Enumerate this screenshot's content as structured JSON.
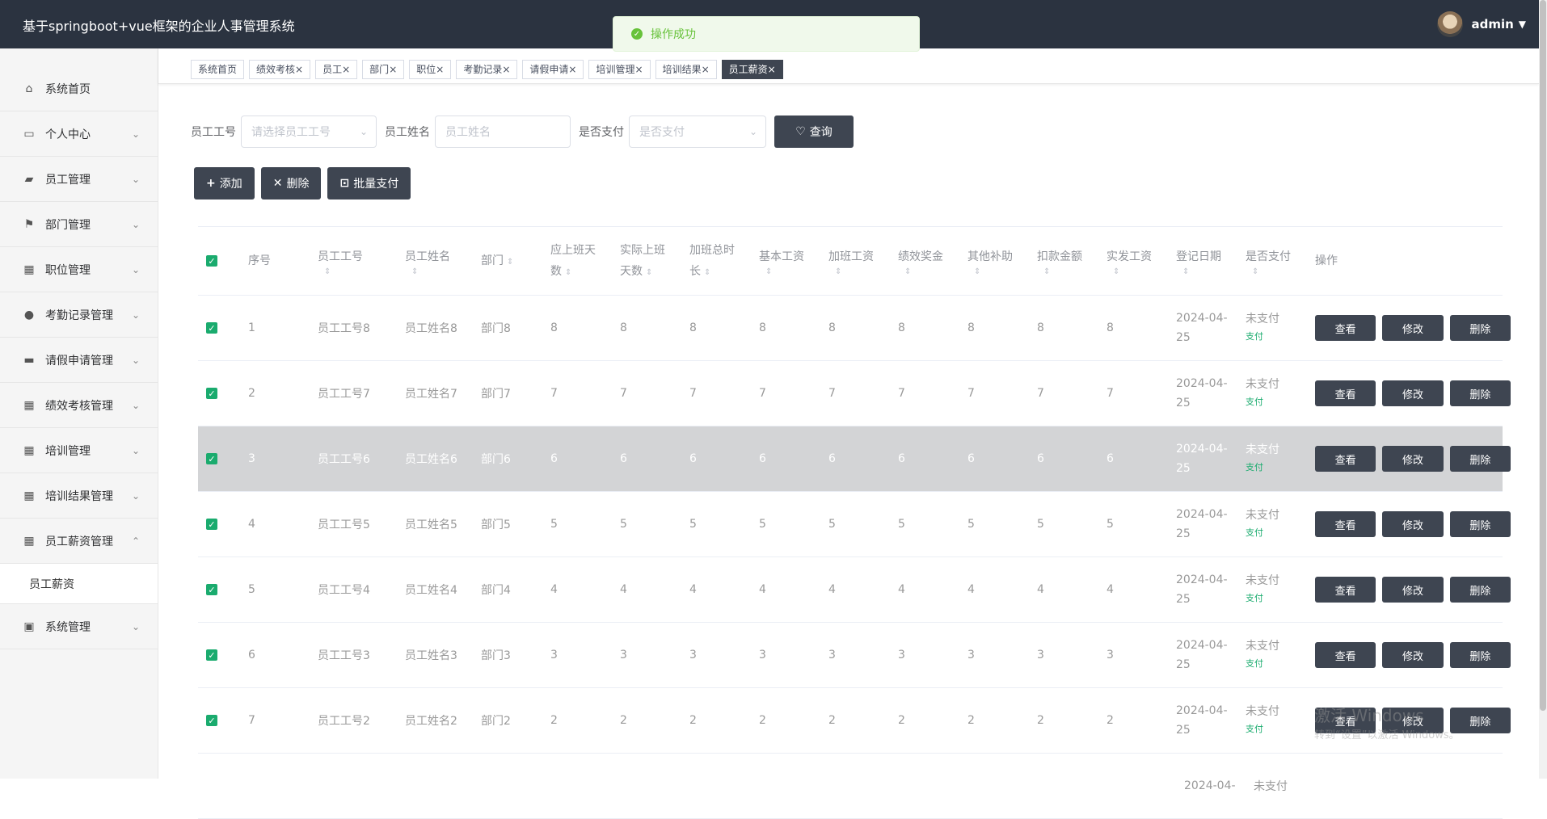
{
  "header": {
    "title": "基于springboot+vue框架的企业人事管理系统",
    "username": "admin"
  },
  "toast": {
    "message": "操作成功"
  },
  "sidebar": {
    "items": [
      {
        "label": "系统首页",
        "icon": "home-icon",
        "glyph": "⌂",
        "arrow": ""
      },
      {
        "label": "个人中心",
        "icon": "card-icon",
        "glyph": "▭",
        "arrow": "⌄"
      },
      {
        "label": "员工管理",
        "icon": "ticket-icon",
        "glyph": "▰",
        "arrow": "⌄"
      },
      {
        "label": "部门管理",
        "icon": "flag-icon",
        "glyph": "⚑",
        "arrow": "⌄"
      },
      {
        "label": "职位管理",
        "icon": "grid-icon",
        "glyph": "▦",
        "arrow": "⌄"
      },
      {
        "label": "考勤记录管理",
        "icon": "user-icon",
        "glyph": "●",
        "arrow": "⌄"
      },
      {
        "label": "请假申请管理",
        "icon": "briefcase-icon",
        "glyph": "▬",
        "arrow": "⌄"
      },
      {
        "label": "绩效考核管理",
        "icon": "grid-icon",
        "glyph": "▦",
        "arrow": "⌄"
      },
      {
        "label": "培训管理",
        "icon": "grid-icon",
        "glyph": "▦",
        "arrow": "⌄"
      },
      {
        "label": "培训结果管理",
        "icon": "grid-icon",
        "glyph": "▦",
        "arrow": "⌄"
      },
      {
        "label": "员工薪资管理",
        "icon": "grid-icon",
        "glyph": "▦",
        "arrow": "⌃"
      }
    ],
    "submenu": {
      "label": "员工薪资"
    },
    "last": {
      "label": "系统管理",
      "icon": "chart-icon",
      "glyph": "▣",
      "arrow": "⌄"
    }
  },
  "tags": [
    {
      "label": "系统首页",
      "close": ""
    },
    {
      "label": "绩效考核",
      "close": "×"
    },
    {
      "label": "员工",
      "close": "×"
    },
    {
      "label": "部门",
      "close": "×"
    },
    {
      "label": "职位",
      "close": "×"
    },
    {
      "label": "考勤记录",
      "close": "×"
    },
    {
      "label": "请假申请",
      "close": "×"
    },
    {
      "label": "培训管理",
      "close": "×"
    },
    {
      "label": "培训结果",
      "close": "×"
    },
    {
      "label": "员工薪资",
      "close": "×",
      "active": true
    }
  ],
  "search": {
    "emp_no_label": "员工工号",
    "emp_no_placeholder": "请选择员工工号",
    "emp_name_label": "员工姓名",
    "emp_name_placeholder": "员工姓名",
    "paid_label": "是否支付",
    "paid_placeholder": "是否支付",
    "query_label": "查询"
  },
  "actions": {
    "add": "添加",
    "delete": "删除",
    "batch_pay": "批量支付"
  },
  "table": {
    "headers": [
      {
        "line1": "序号",
        "line2": "",
        "sort": false
      },
      {
        "line1": "员工工号",
        "line2": "",
        "sort": true
      },
      {
        "line1": "员工姓名",
        "line2": "",
        "sort": true
      },
      {
        "line1": "部门",
        "line2": "",
        "sort": true,
        "inline": true
      },
      {
        "line1": "应上班天",
        "line2": "数",
        "sort": true
      },
      {
        "line1": "实际上班",
        "line2": "天数",
        "sort": true
      },
      {
        "line1": "加班总时",
        "line2": "长",
        "sort": true
      },
      {
        "line1": "基本工资",
        "line2": "",
        "sort": true
      },
      {
        "line1": "加班工资",
        "line2": "",
        "sort": true
      },
      {
        "line1": "绩效奖金",
        "line2": "",
        "sort": true
      },
      {
        "line1": "其他补助",
        "line2": "",
        "sort": true
      },
      {
        "line1": "扣款金额",
        "line2": "",
        "sort": true
      },
      {
        "line1": "实发工资",
        "line2": "",
        "sort": true
      },
      {
        "line1": "登记日期",
        "line2": "",
        "sort": true
      },
      {
        "line1": "是否支付",
        "line2": "",
        "sort": true
      },
      {
        "line1": "操作",
        "line2": "",
        "sort": false
      }
    ],
    "rows": [
      {
        "idx": "1",
        "emp_no": "员工工号8",
        "emp_name": "员工姓名8",
        "dept": "部门8",
        "v": "8",
        "date1": "2024-04-",
        "date2": "25",
        "paid": "未支付",
        "pay": "支付"
      },
      {
        "idx": "2",
        "emp_no": "员工工号7",
        "emp_name": "员工姓名7",
        "dept": "部门7",
        "v": "7",
        "date1": "2024-04-",
        "date2": "25",
        "paid": "未支付",
        "pay": "支付"
      },
      {
        "idx": "3",
        "emp_no": "员工工号6",
        "emp_name": "员工姓名6",
        "dept": "部门6",
        "v": "6",
        "date1": "2024-04-",
        "date2": "25",
        "paid": "未支付",
        "pay": "支付",
        "hover": true
      },
      {
        "idx": "4",
        "emp_no": "员工工号5",
        "emp_name": "员工姓名5",
        "dept": "部门5",
        "v": "5",
        "date1": "2024-04-",
        "date2": "25",
        "paid": "未支付",
        "pay": "支付"
      },
      {
        "idx": "5",
        "emp_no": "员工工号4",
        "emp_name": "员工姓名4",
        "dept": "部门4",
        "v": "4",
        "date1": "2024-04-",
        "date2": "25",
        "paid": "未支付",
        "pay": "支付"
      },
      {
        "idx": "6",
        "emp_no": "员工工号3",
        "emp_name": "员工姓名3",
        "dept": "部门3",
        "v": "3",
        "date1": "2024-04-",
        "date2": "25",
        "paid": "未支付",
        "pay": "支付"
      },
      {
        "idx": "7",
        "emp_no": "员工工号2",
        "emp_name": "员工姓名2",
        "dept": "部门2",
        "v": "2",
        "date1": "2024-04-",
        "date2": "25",
        "paid": "未支付",
        "pay": "支付"
      }
    ],
    "partial_row": {
      "date1": "2024-04-",
      "paid": "未支付"
    },
    "ops": {
      "view": "查看",
      "edit": "修改",
      "delete": "删除"
    }
  },
  "watermark": {
    "line1": "激活 Windows",
    "line2": "转到“设置”以激活 Windows。"
  }
}
